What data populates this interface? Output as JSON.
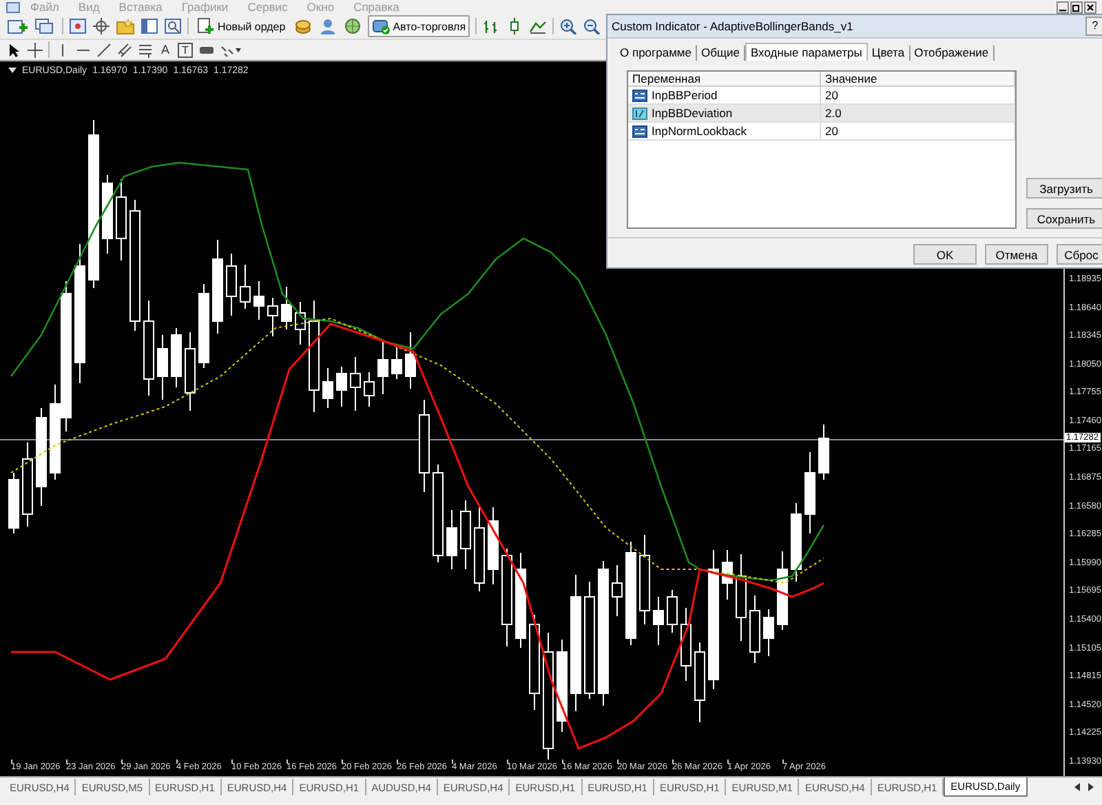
{
  "menu": [
    "Файл",
    "Вид",
    "Вставка",
    "Графики",
    "Сервис",
    "Окно",
    "Справка"
  ],
  "toolbar": {
    "new_order": "Новый ордер",
    "auto_trading": "Авто-торговля"
  },
  "drawing_tools": {
    "text_tool": "A",
    "label_tool": "T"
  },
  "chart": {
    "symbol": "EURUSD,Daily",
    "ohlc": [
      "1.16970",
      "1.17390",
      "1.16763",
      "1.17282"
    ],
    "current_price": "1.17282",
    "price_axis": [
      "1.18935",
      "1.18640",
      "1.18345",
      "1.18050",
      "1.17755",
      "1.17460",
      "1.17165",
      "1.16875",
      "1.16580",
      "1.16285",
      "1.15990",
      "1.15695",
      "1.15400",
      "1.15105",
      "1.14815",
      "1.14520",
      "1.14225",
      "1.13930"
    ],
    "time_axis": [
      "19 Jan 2026",
      "23 Jan 2026",
      "29 Jan 2026",
      "4 Feb 2026",
      "10 Feb 2026",
      "16 Feb 2026",
      "20 Feb 2026",
      "26 Feb 2026",
      "4 Mar 2026",
      "10 Mar 2026",
      "16 Mar 2026",
      "20 Mar 2026",
      "26 Mar 2026",
      "1 Apr 2026",
      "7 Apr 2026"
    ]
  },
  "dialog": {
    "title": "Custom Indicator - AdaptiveBollingerBands_v1",
    "help": "?",
    "tabs": [
      {
        "label": "О программе",
        "selected": false
      },
      {
        "label": "Общие",
        "selected": false
      },
      {
        "label": "Входные параметры",
        "selected": true
      },
      {
        "label": "Цвета",
        "selected": false
      },
      {
        "label": "Отображение",
        "selected": false
      }
    ],
    "table": {
      "columns": [
        "Переменная",
        "Значение"
      ],
      "rows": [
        {
          "kind": "int",
          "name": "InpBBPeriod",
          "value": "20",
          "selected": false
        },
        {
          "kind": "double",
          "name": "InpBBDeviation",
          "value": "2.0",
          "selected": true
        },
        {
          "kind": "int",
          "name": "InpNormLookback",
          "value": "20",
          "selected": false
        }
      ]
    },
    "side_buttons": [
      "Загрузить",
      "Сохранить"
    ],
    "buttons": [
      "OK",
      "Отмена",
      "Сброс"
    ]
  },
  "chart_tabs": [
    {
      "label": "EURUSD,H4",
      "selected": false
    },
    {
      "label": "EURUSD,M5",
      "selected": false
    },
    {
      "label": "EURUSD,H1",
      "selected": false
    },
    {
      "label": "EURUSD,H4",
      "selected": false
    },
    {
      "label": "EURUSD,H1",
      "selected": false
    },
    {
      "label": "AUDUSD,H4",
      "selected": false
    },
    {
      "label": "EURUSD,H4",
      "selected": false
    },
    {
      "label": "EURUSD,H1",
      "selected": false
    },
    {
      "label": "EURUSD,H1",
      "selected": false
    },
    {
      "label": "EURUSD,H1",
      "selected": false
    },
    {
      "label": "EURUSD,M1",
      "selected": false
    },
    {
      "label": "EURUSD,H4",
      "selected": false
    },
    {
      "label": "EURUSD,H1",
      "selected": false
    },
    {
      "label": "EURUSD,Daily",
      "selected": true
    }
  ]
}
